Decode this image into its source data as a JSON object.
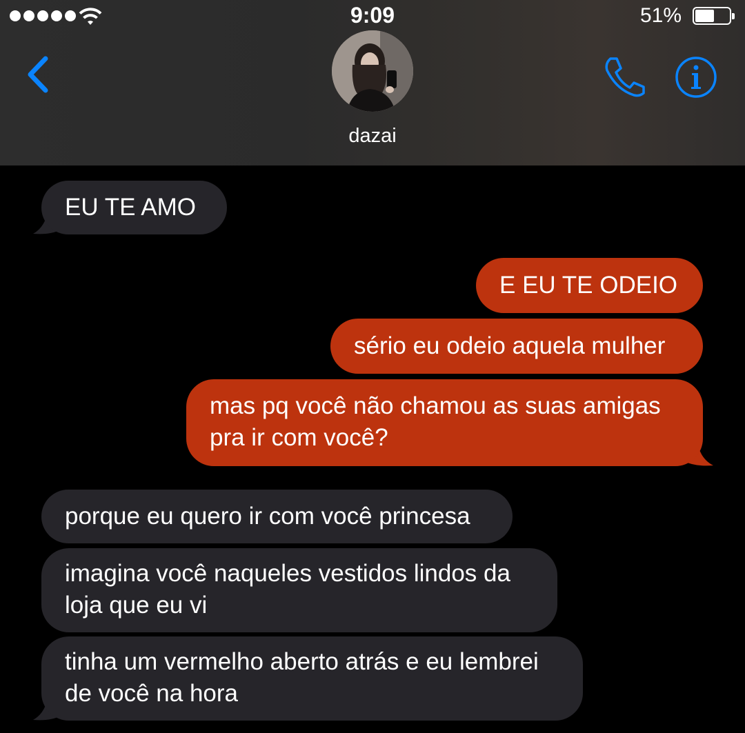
{
  "status_bar": {
    "time": "9:09",
    "battery_percent": "51%",
    "signal_bars": 5,
    "icons": [
      "signal-dots-icon",
      "wifi-icon",
      "battery-icon"
    ]
  },
  "header": {
    "contact_name": "dazai",
    "icons": [
      "back-chevron-icon",
      "phone-icon",
      "info-icon",
      "contact-avatar"
    ],
    "accent_color": "#0a84ff"
  },
  "colors": {
    "incoming_bubble": "#26252a",
    "outgoing_bubble": "#bd330e",
    "background": "#000000"
  },
  "messages": [
    {
      "direction": "incoming",
      "text": "EU TE AMO"
    },
    {
      "direction": "outgoing",
      "text": "E EU TE ODEIO"
    },
    {
      "direction": "outgoing",
      "text": "sério eu odeio aquela mulher"
    },
    {
      "direction": "outgoing",
      "lines": [
        "mas pq você não chamou as suas amigas",
        "pra ir com você?"
      ]
    },
    {
      "direction": "incoming",
      "text": "porque eu quero ir com você princesa"
    },
    {
      "direction": "incoming",
      "lines": [
        "imagina você naqueles vestidos lindos da",
        "loja que eu vi"
      ]
    },
    {
      "direction": "incoming",
      "lines": [
        "tinha um vermelho aberto atrás e eu lembrei",
        "de você na hora"
      ]
    }
  ]
}
